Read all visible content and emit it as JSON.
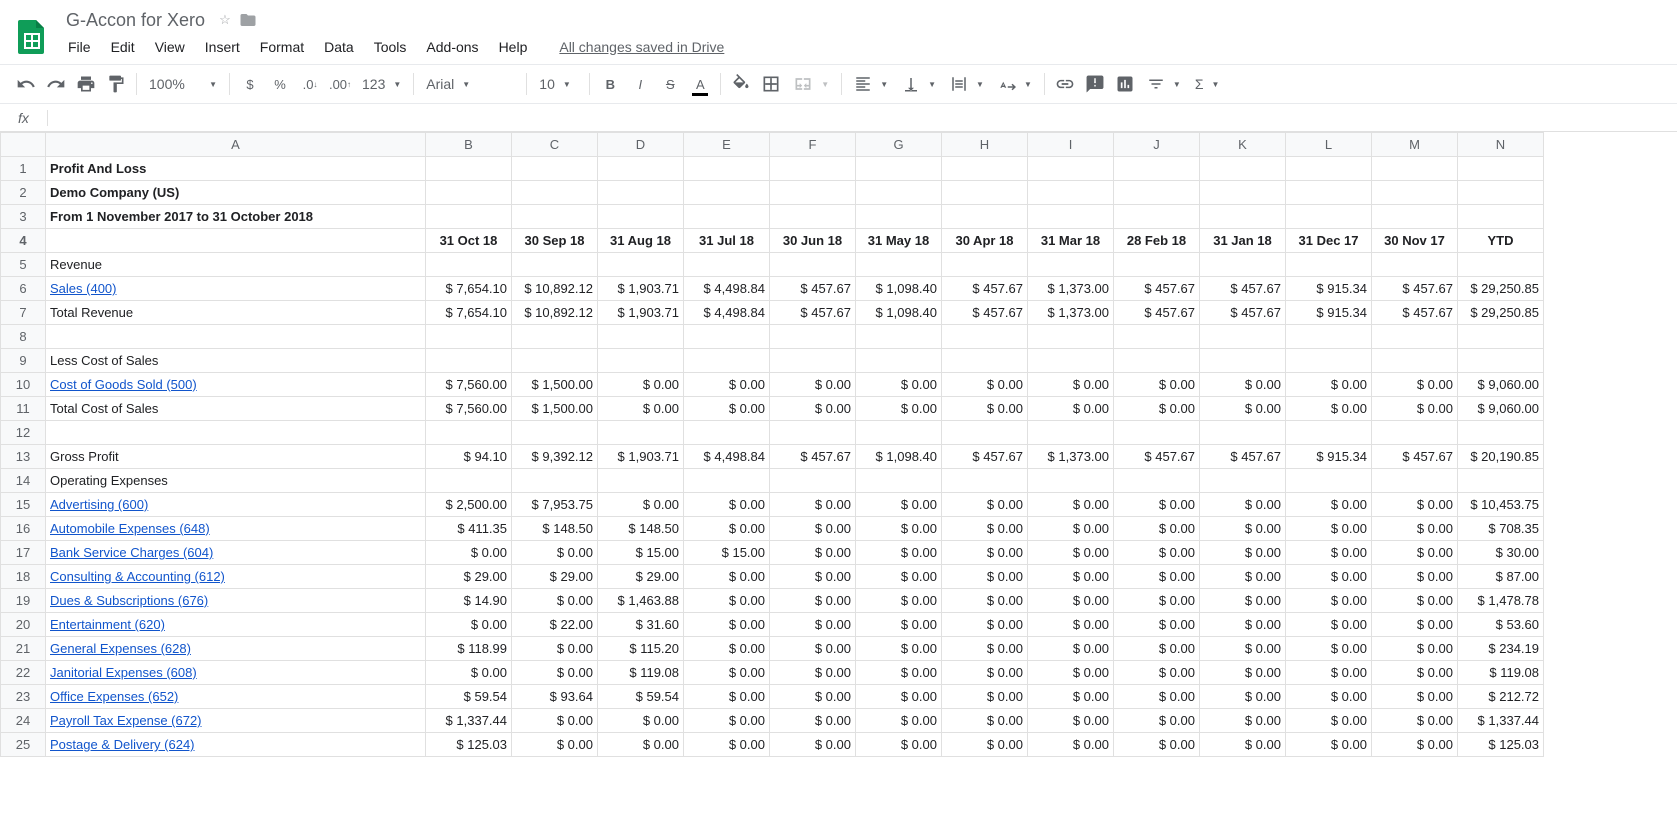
{
  "doc_title": "G-Accon for Xero",
  "menus": [
    "File",
    "Edit",
    "View",
    "Insert",
    "Format",
    "Data",
    "Tools",
    "Add-ons",
    "Help"
  ],
  "save_status": "All changes saved in Drive",
  "toolbar": {
    "zoom": "100%",
    "font": "Arial",
    "font_size": "10"
  },
  "formula_bar": {
    "label": "fx",
    "value": ""
  },
  "columns": [
    "A",
    "B",
    "C",
    "D",
    "E",
    "F",
    "G",
    "H",
    "I",
    "J",
    "K",
    "L",
    "M",
    "N"
  ],
  "headers": [
    "",
    "31 Oct 18",
    "30 Sep 18",
    "31 Aug 18",
    "31 Jul 18",
    "30 Jun 18",
    "31 May 18",
    "30 Apr 18",
    "31 Mar 18",
    "28 Feb 18",
    "31 Jan 18",
    "31 Dec 17",
    "30 Nov 17",
    "YTD"
  ],
  "title_rows": [
    "Profit And Loss",
    "Demo Company (US)",
    "From 1 November 2017 to 31 October 2018"
  ],
  "data_rows": [
    {
      "r": 5,
      "label": "Revenue",
      "link": false,
      "cells": [
        "",
        "",
        "",
        "",
        "",
        "",
        "",
        "",
        "",
        "",
        "",
        "",
        ""
      ]
    },
    {
      "r": 6,
      "label": "Sales (400)",
      "link": true,
      "cells": [
        "$ 7,654.10",
        "$ 10,892.12",
        "$ 1,903.71",
        "$ 4,498.84",
        "$ 457.67",
        "$ 1,098.40",
        "$ 457.67",
        "$ 1,373.00",
        "$ 457.67",
        "$ 457.67",
        "$ 915.34",
        "$ 457.67",
        "$ 29,250.85"
      ]
    },
    {
      "r": 7,
      "label": "Total Revenue",
      "link": false,
      "cells": [
        "$ 7,654.10",
        "$ 10,892.12",
        "$ 1,903.71",
        "$ 4,498.84",
        "$ 457.67",
        "$ 1,098.40",
        "$ 457.67",
        "$ 1,373.00",
        "$ 457.67",
        "$ 457.67",
        "$ 915.34",
        "$ 457.67",
        "$ 29,250.85"
      ]
    },
    {
      "r": 8,
      "label": "",
      "link": false,
      "cells": [
        "",
        "",
        "",
        "",
        "",
        "",
        "",
        "",
        "",
        "",
        "",
        "",
        ""
      ]
    },
    {
      "r": 9,
      "label": "Less Cost of Sales",
      "link": false,
      "cells": [
        "",
        "",
        "",
        "",
        "",
        "",
        "",
        "",
        "",
        "",
        "",
        "",
        ""
      ]
    },
    {
      "r": 10,
      "label": "Cost of Goods Sold (500)",
      "link": true,
      "cells": [
        "$ 7,560.00",
        "$ 1,500.00",
        "$ 0.00",
        "$ 0.00",
        "$ 0.00",
        "$ 0.00",
        "$ 0.00",
        "$ 0.00",
        "$ 0.00",
        "$ 0.00",
        "$ 0.00",
        "$ 0.00",
        "$ 9,060.00"
      ]
    },
    {
      "r": 11,
      "label": "Total Cost of Sales",
      "link": false,
      "cells": [
        "$ 7,560.00",
        "$ 1,500.00",
        "$ 0.00",
        "$ 0.00",
        "$ 0.00",
        "$ 0.00",
        "$ 0.00",
        "$ 0.00",
        "$ 0.00",
        "$ 0.00",
        "$ 0.00",
        "$ 0.00",
        "$ 9,060.00"
      ]
    },
    {
      "r": 12,
      "label": "",
      "link": false,
      "cells": [
        "",
        "",
        "",
        "",
        "",
        "",
        "",
        "",
        "",
        "",
        "",
        "",
        ""
      ]
    },
    {
      "r": 13,
      "label": "Gross Profit",
      "link": false,
      "cells": [
        "$ 94.10",
        "$ 9,392.12",
        "$ 1,903.71",
        "$ 4,498.84",
        "$ 457.67",
        "$ 1,098.40",
        "$ 457.67",
        "$ 1,373.00",
        "$ 457.67",
        "$ 457.67",
        "$ 915.34",
        "$ 457.67",
        "$ 20,190.85"
      ]
    },
    {
      "r": 14,
      "label": "Operating Expenses",
      "link": false,
      "cells": [
        "",
        "",
        "",
        "",
        "",
        "",
        "",
        "",
        "",
        "",
        "",
        "",
        ""
      ]
    },
    {
      "r": 15,
      "label": "Advertising (600)",
      "link": true,
      "cells": [
        "$ 2,500.00",
        "$ 7,953.75",
        "$ 0.00",
        "$ 0.00",
        "$ 0.00",
        "$ 0.00",
        "$ 0.00",
        "$ 0.00",
        "$ 0.00",
        "$ 0.00",
        "$ 0.00",
        "$ 0.00",
        "$ 10,453.75"
      ]
    },
    {
      "r": 16,
      "label": "Automobile Expenses (648)",
      "link": true,
      "cells": [
        "$ 411.35",
        "$ 148.50",
        "$ 148.50",
        "$ 0.00",
        "$ 0.00",
        "$ 0.00",
        "$ 0.00",
        "$ 0.00",
        "$ 0.00",
        "$ 0.00",
        "$ 0.00",
        "$ 0.00",
        "$ 708.35"
      ]
    },
    {
      "r": 17,
      "label": "Bank Service Charges (604)",
      "link": true,
      "cells": [
        "$ 0.00",
        "$ 0.00",
        "$ 15.00",
        "$ 15.00",
        "$ 0.00",
        "$ 0.00",
        "$ 0.00",
        "$ 0.00",
        "$ 0.00",
        "$ 0.00",
        "$ 0.00",
        "$ 0.00",
        "$ 30.00"
      ]
    },
    {
      "r": 18,
      "label": "Consulting & Accounting (612)",
      "link": true,
      "cells": [
        "$ 29.00",
        "$ 29.00",
        "$ 29.00",
        "$ 0.00",
        "$ 0.00",
        "$ 0.00",
        "$ 0.00",
        "$ 0.00",
        "$ 0.00",
        "$ 0.00",
        "$ 0.00",
        "$ 0.00",
        "$ 87.00"
      ]
    },
    {
      "r": 19,
      "label": "Dues & Subscriptions (676)",
      "link": true,
      "cells": [
        "$ 14.90",
        "$ 0.00",
        "$ 1,463.88",
        "$ 0.00",
        "$ 0.00",
        "$ 0.00",
        "$ 0.00",
        "$ 0.00",
        "$ 0.00",
        "$ 0.00",
        "$ 0.00",
        "$ 0.00",
        "$ 1,478.78"
      ]
    },
    {
      "r": 20,
      "label": "Entertainment (620)",
      "link": true,
      "cells": [
        "$ 0.00",
        "$ 22.00",
        "$ 31.60",
        "$ 0.00",
        "$ 0.00",
        "$ 0.00",
        "$ 0.00",
        "$ 0.00",
        "$ 0.00",
        "$ 0.00",
        "$ 0.00",
        "$ 0.00",
        "$ 53.60"
      ]
    },
    {
      "r": 21,
      "label": "General Expenses (628)",
      "link": true,
      "cells": [
        "$ 118.99",
        "$ 0.00",
        "$ 115.20",
        "$ 0.00",
        "$ 0.00",
        "$ 0.00",
        "$ 0.00",
        "$ 0.00",
        "$ 0.00",
        "$ 0.00",
        "$ 0.00",
        "$ 0.00",
        "$ 234.19"
      ]
    },
    {
      "r": 22,
      "label": "Janitorial Expenses (608)",
      "link": true,
      "cells": [
        "$ 0.00",
        "$ 0.00",
        "$ 119.08",
        "$ 0.00",
        "$ 0.00",
        "$ 0.00",
        "$ 0.00",
        "$ 0.00",
        "$ 0.00",
        "$ 0.00",
        "$ 0.00",
        "$ 0.00",
        "$ 119.08"
      ]
    },
    {
      "r": 23,
      "label": "Office Expenses (652)",
      "link": true,
      "cells": [
        "$ 59.54",
        "$ 93.64",
        "$ 59.54",
        "$ 0.00",
        "$ 0.00",
        "$ 0.00",
        "$ 0.00",
        "$ 0.00",
        "$ 0.00",
        "$ 0.00",
        "$ 0.00",
        "$ 0.00",
        "$ 212.72"
      ]
    },
    {
      "r": 24,
      "label": "Payroll Tax Expense (672)",
      "link": true,
      "cells": [
        "$ 1,337.44",
        "$ 0.00",
        "$ 0.00",
        "$ 0.00",
        "$ 0.00",
        "$ 0.00",
        "$ 0.00",
        "$ 0.00",
        "$ 0.00",
        "$ 0.00",
        "$ 0.00",
        "$ 0.00",
        "$ 1,337.44"
      ]
    },
    {
      "r": 25,
      "label": "Postage & Delivery (624)",
      "link": true,
      "cells": [
        "$ 125.03",
        "$ 0.00",
        "$ 0.00",
        "$ 0.00",
        "$ 0.00",
        "$ 0.00",
        "$ 0.00",
        "$ 0.00",
        "$ 0.00",
        "$ 0.00",
        "$ 0.00",
        "$ 0.00",
        "$ 125.03"
      ]
    }
  ]
}
